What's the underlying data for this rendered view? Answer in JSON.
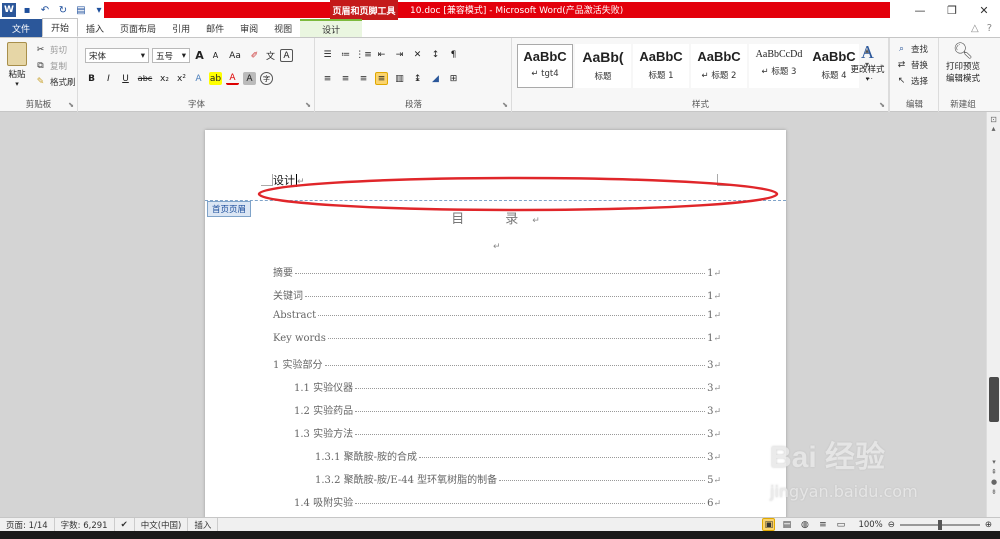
{
  "titlebar": {
    "context_tool_title": "页眉和页脚工具",
    "window_title": "10.doc [兼容模式] - Microsoft Word(产品激活失败)",
    "word_logo": "W"
  },
  "tabs": {
    "file": "文件",
    "items": [
      "开始",
      "插入",
      "页面布局",
      "引用",
      "邮件",
      "审阅",
      "视图"
    ],
    "contextual": "设计"
  },
  "ribbon": {
    "clipboard": {
      "label": "剪贴板",
      "paste": "粘贴",
      "cut": "剪切",
      "copy": "复制",
      "format_painter": "格式刷"
    },
    "font": {
      "label": "字体",
      "font_name": "宋体",
      "font_size": "五号",
      "change_case": "Aa",
      "bold": "B",
      "italic": "I",
      "underline": "U",
      "strike": "abc",
      "subscript": "x₂",
      "superscript": "x²",
      "grow": "A",
      "shrink": "A",
      "font_color": "A",
      "char_shade": "A",
      "enclose": "字"
    },
    "paragraph": {
      "label": "段落"
    },
    "styles": {
      "label": "样式",
      "items": [
        {
          "preview": "AaBbC",
          "name": "↵ tgt4"
        },
        {
          "preview": "AaBb(",
          "name": "标题"
        },
        {
          "preview": "AaBbC",
          "name": "标题 1"
        },
        {
          "preview": "AaBbC",
          "name": "↵ 标题 2"
        },
        {
          "preview": "AaBbCcDd",
          "name": "↵ 标题 3"
        },
        {
          "preview": "AaBbC",
          "name": "标题 4"
        }
      ],
      "change_styles": "更改样式"
    },
    "editing": {
      "label": "编辑",
      "find": "查找",
      "replace": "替换",
      "select": "选择"
    },
    "newgroup": {
      "label": "新建组",
      "print_preview": "打印预览",
      "edit_mode": "编辑模式"
    }
  },
  "document": {
    "header_text": "设计",
    "header_tag": "首页页眉",
    "toc_heading": "目　录",
    "toc": [
      {
        "text": "摘要",
        "page": "1"
      },
      {
        "text": "关键词",
        "page": "1"
      },
      {
        "text": "Abstract",
        "page": "1"
      },
      {
        "text": "Key words",
        "page": "1"
      },
      {
        "text": "1  实验部分",
        "page": "3"
      },
      {
        "text": "1.1  实验仪器",
        "page": "3"
      },
      {
        "text": "1.2  实验药品",
        "page": "3"
      },
      {
        "text": "1.3  实验方法",
        "page": "3"
      },
      {
        "text": "1.3.1  聚酰胺-胺的合成",
        "page": "3"
      },
      {
        "text": "1.3.2  聚酰胺-胺/E-44 型环氧树脂的制备",
        "page": "5"
      },
      {
        "text": "1.4  吸附实验",
        "page": "6"
      }
    ]
  },
  "statusbar": {
    "page": "页面: 1/14",
    "words": "字数: 6,291",
    "language": "中文(中国)",
    "insert_mode": "插入",
    "zoom": "100%"
  },
  "watermark": {
    "brand": "Bai 经验",
    "url": "jingyan.baidu.com"
  },
  "colors": {
    "accent": "#2b579a",
    "red_bar": "#e3000b",
    "annotation": "#e0262a"
  }
}
